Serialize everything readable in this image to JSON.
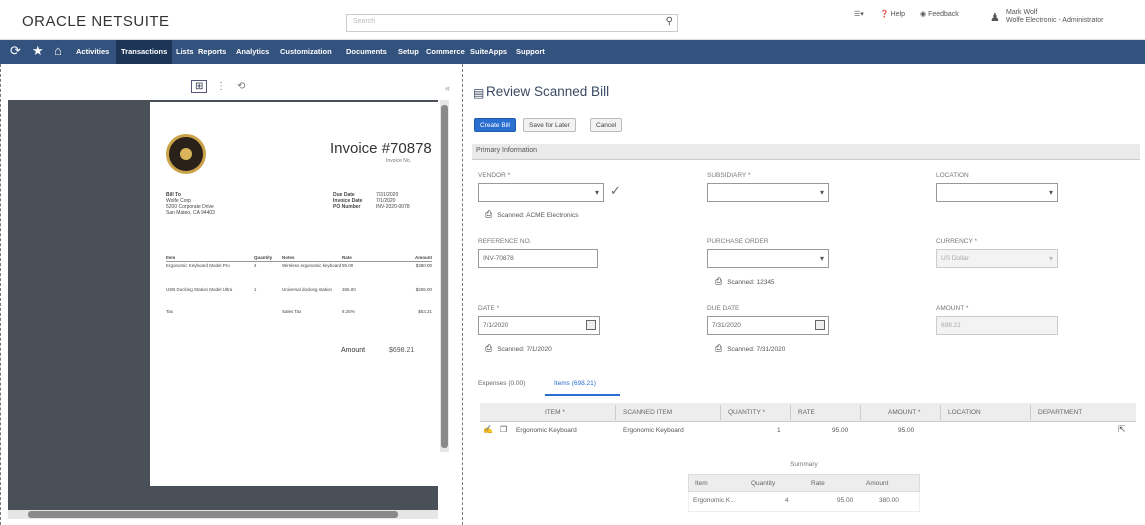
{
  "app": {
    "logo": "ORACLE NETSUITE",
    "search_placeholder": "Search"
  },
  "topbar": {
    "help": "Help",
    "feedback": "Feedback",
    "user_name": "Mark Wolf",
    "user_role": "Wolfe Electronic - Administrator"
  },
  "nav": {
    "items": [
      "Activities",
      "Transactions",
      "Lists",
      "Reports",
      "Analytics",
      "Customization",
      "Documents",
      "Setup",
      "Commerce",
      "SuiteApps",
      "Support"
    ],
    "active": "Transactions"
  },
  "viewer": {
    "tool_fit": "⊞",
    "tool_page": "⋮",
    "tool_rotate": "⟲",
    "collapse": "«"
  },
  "invoice": {
    "title": "Invoice #70878",
    "subtitle": "Invoice No.",
    "bill_to": [
      "Bill To",
      "Wolfe Corp",
      "5200 Corporate Drive",
      "San Mateo, CA 94403"
    ],
    "meta_labels": [
      "Due Date",
      "Invoice Date",
      "PO Number"
    ],
    "meta_values": [
      "7/31/2020",
      "7/1/2020",
      "INV-2020-0078"
    ],
    "table": {
      "headers": [
        "Item",
        "Quantity",
        "Notes",
        "Rate",
        "Amount"
      ],
      "rows": [
        [
          "Ergonomic Keyboard Model Pro",
          "4",
          "Wireless ergonomic keyboard",
          "95.00",
          "$380.00"
        ],
        [
          "USB Docking Station Model Ultra",
          "1",
          "Universal docking station",
          "265.00",
          "$265.00"
        ],
        [
          "Tax",
          "",
          "Sales Tax",
          "8.25%",
          "$53.21"
        ]
      ]
    },
    "amount_label": "Amount",
    "amount_value": "$698.21"
  },
  "form": {
    "title": "Review Scanned Bill",
    "buttons": [
      "Create Bill",
      "Save for Later",
      "Cancel"
    ],
    "section": "Primary Information",
    "labels": {
      "vendor": "Vendor *",
      "subsidiary": "Subsidiary *",
      "location": "Location",
      "reference": "Reference No.",
      "purchase_order": "Purchase Order",
      "currency": "Currency *",
      "date": "Date *",
      "due_date": "Due Date",
      "amount": "Amount *"
    },
    "values": {
      "vendor": "",
      "subsidiary": "",
      "location": "",
      "reference": "INV-70878",
      "purchase_order": "",
      "currency": "US Dollar",
      "date": "7/1/2020",
      "due_date": "7/31/2020",
      "amount": "698.21"
    },
    "links": {
      "vendor": "Scanned: ACME Electronics",
      "purchase_order": "Scanned: 12345",
      "date": "Scanned: 7/1/2020",
      "due_date": "Scanned: 7/31/2020"
    }
  },
  "tabs": {
    "items": [
      "Expenses (0.00)",
      "Items (698.21)"
    ],
    "active": "Items (698.21)"
  },
  "grid": {
    "headers": [
      "Item *",
      "Scanned Item",
      "Quantity *",
      "Rate",
      "Amount *",
      "Location",
      "Department"
    ],
    "rows": [
      {
        "item": "Ergonomic Keyboard",
        "scanned": "Ergonomic Keyboard",
        "qty": "1",
        "rate": "95.00",
        "amount": "95.00"
      }
    ]
  },
  "summary": {
    "title": "Summary",
    "headers": [
      "Item",
      "Quantity",
      "Rate",
      "Amount"
    ],
    "rows": [
      {
        "item": "Ergonomic K...",
        "qty": "4",
        "rate": "95.00",
        "amount": "380.00"
      }
    ]
  }
}
